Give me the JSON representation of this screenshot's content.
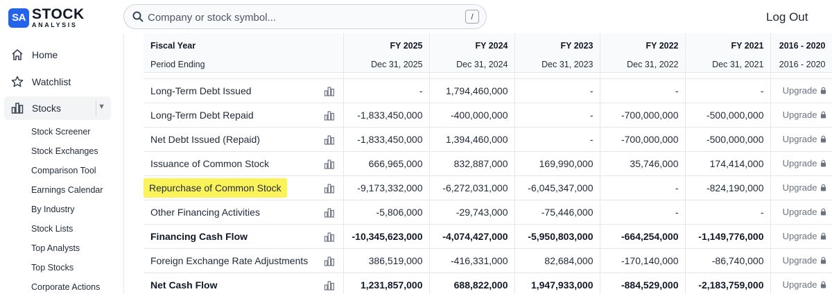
{
  "brand": {
    "logo_mark": "SA",
    "name_line1": "STOCK",
    "name_line2": "ANALYSIS"
  },
  "search": {
    "placeholder": "Company or stock symbol...",
    "shortcut": "/"
  },
  "header": {
    "logout_label": "Log Out"
  },
  "sidebar": {
    "main": [
      {
        "label": "Home",
        "icon": "home-icon"
      },
      {
        "label": "Watchlist",
        "icon": "star-icon"
      },
      {
        "label": "Stocks",
        "icon": "bar-chart-icon",
        "expanded": true
      }
    ],
    "sub": [
      "Stock Screener",
      "Stock Exchanges",
      "Comparison Tool",
      "Earnings Calendar",
      "By Industry",
      "Stock Lists",
      "Top Analysts",
      "Top Stocks",
      "Corporate Actions"
    ]
  },
  "table": {
    "header": {
      "label_line1": "Fiscal Year",
      "label_line2": "Period Ending",
      "columns": [
        {
          "year": "FY 2025",
          "date": "Dec 31, 2025"
        },
        {
          "year": "FY 2024",
          "date": "Dec 31, 2024"
        },
        {
          "year": "FY 2023",
          "date": "Dec 31, 2023"
        },
        {
          "year": "FY 2022",
          "date": "Dec 31, 2022"
        },
        {
          "year": "FY 2021",
          "date": "Dec 31, 2021"
        },
        {
          "year": "2016 - 2020",
          "date": "2016 - 2020"
        }
      ]
    },
    "upgrade_label": "Upgrade",
    "rows": [
      {
        "label": "Long-Term Debt Issued",
        "values": [
          "-",
          "1,794,460,000",
          "-",
          "-",
          "-"
        ],
        "bold": false
      },
      {
        "label": "Long-Term Debt Repaid",
        "values": [
          "-1,833,450,000",
          "-400,000,000",
          "-",
          "-700,000,000",
          "-500,000,000"
        ],
        "bold": false
      },
      {
        "label": "Net Debt Issued (Repaid)",
        "values": [
          "-1,833,450,000",
          "1,394,460,000",
          "-",
          "-700,000,000",
          "-500,000,000"
        ],
        "bold": false
      },
      {
        "label": "Issuance of Common Stock",
        "values": [
          "666,965,000",
          "832,887,000",
          "169,990,000",
          "35,746,000",
          "174,414,000"
        ],
        "bold": false
      },
      {
        "label": "Repurchase of Common Stock",
        "values": [
          "-9,173,332,000",
          "-6,272,031,000",
          "-6,045,347,000",
          "-",
          "-824,190,000"
        ],
        "bold": false,
        "highlighted": true
      },
      {
        "label": "Other Financing Activities",
        "values": [
          "-5,806,000",
          "-29,743,000",
          "-75,446,000",
          "-",
          "-"
        ],
        "bold": false
      },
      {
        "label": "Financing Cash Flow",
        "values": [
          "-10,345,623,000",
          "-4,074,427,000",
          "-5,950,803,000",
          "-664,254,000",
          "-1,149,776,000"
        ],
        "bold": true
      },
      {
        "label": "Foreign Exchange Rate Adjustments",
        "values": [
          "386,519,000",
          "-416,331,000",
          "82,684,000",
          "-170,140,000",
          "-86,740,000"
        ],
        "bold": false
      },
      {
        "label": "Net Cash Flow",
        "values": [
          "1,231,857,000",
          "688,822,000",
          "1,947,933,000",
          "-884,529,000",
          "-2,183,759,000"
        ],
        "bold": true
      }
    ]
  },
  "colors": {
    "accent": "#2563eb",
    "highlight": "#fbf35a",
    "grid": "#e5e7eb"
  }
}
